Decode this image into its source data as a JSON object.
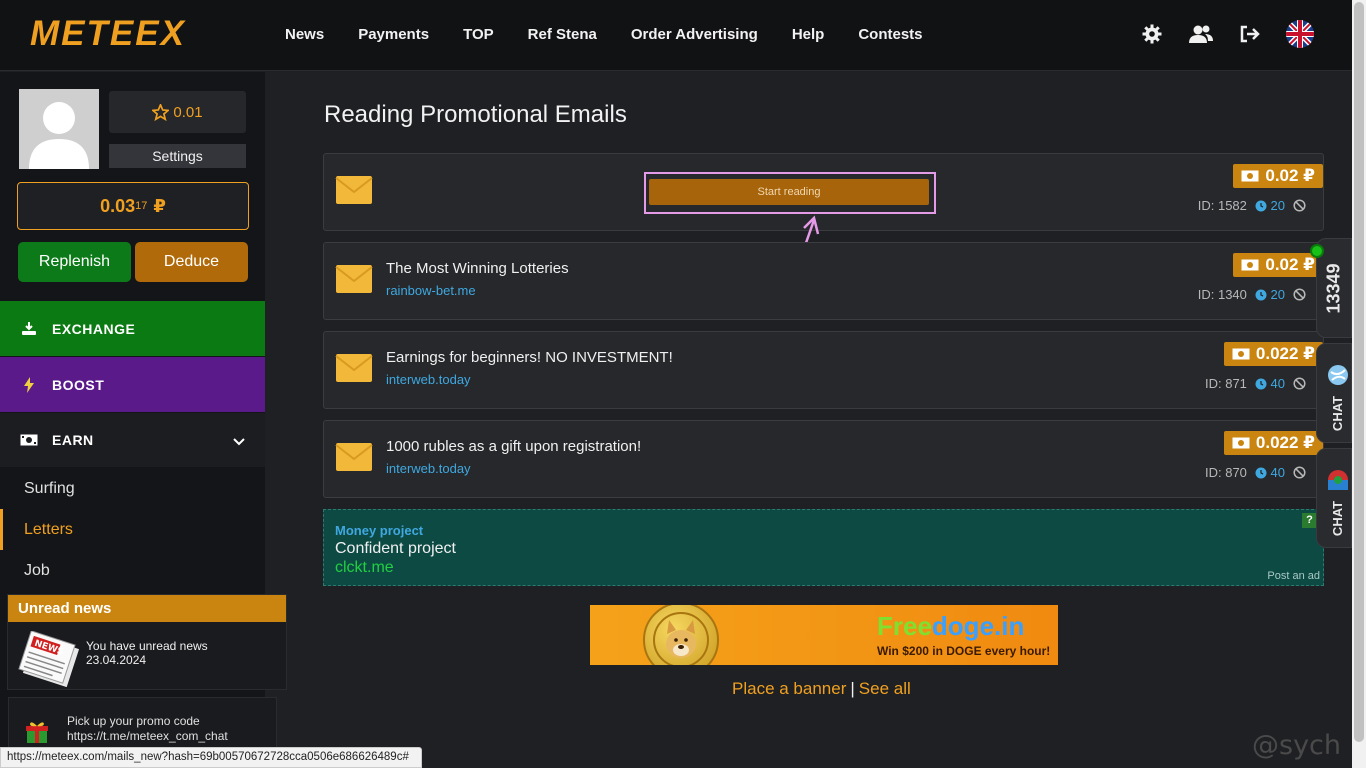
{
  "header": {
    "logo": "METEEX",
    "nav": [
      "News",
      "Payments",
      "TOP",
      "Ref Stena",
      "Order Advertising",
      "Help",
      "Contests"
    ],
    "icons": [
      "gear-icon",
      "users-icon",
      "logout-icon",
      "uk-flag-icon"
    ]
  },
  "sidebar": {
    "rating": "0.01",
    "settings_label": "Settings",
    "balance_main": "0.03",
    "balance_small": "17",
    "balance_currency": "₽",
    "replenish_label": "Replenish",
    "deduce_label": "Deduce",
    "exchange_label": "EXCHANGE",
    "boost_label": "BOOST",
    "earn_label": "EARN",
    "submenu": [
      "Surfing",
      "Letters",
      "Job"
    ],
    "news_header": "Unread news",
    "news_text": "You have unread news",
    "news_date": "23.04.2024",
    "promo_text": "Pick up your promo code",
    "promo_link": "https://t.me/meteex_com_chat"
  },
  "main": {
    "title": "Reading Promotional Emails",
    "start_reading_label": "Start reading",
    "cards": [
      {
        "title": "",
        "link": "",
        "price": "0.02 ₽",
        "id": "ID: 1582",
        "time": "20"
      },
      {
        "title": "The Most Winning Lotteries",
        "link": "rainbow-bet.me",
        "price": "0.02 ₽",
        "id": "ID: 1340",
        "time": "20"
      },
      {
        "title": "Earnings for beginners! NO INVESTMENT!",
        "link": "interweb.today",
        "price": "0.022 ₽",
        "id": "ID: 871",
        "time": "40"
      },
      {
        "title": "1000 rubles as a gift upon registration!",
        "link": "interweb.today",
        "price": "0.022 ₽",
        "id": "ID: 870",
        "time": "40"
      }
    ],
    "ad": {
      "label": "Money project",
      "title": "Confident project",
      "link": "clckt.me",
      "post": "Post an ad",
      "help": "?"
    },
    "banner": {
      "brand_a": "Free",
      "brand_b": "doge.in",
      "sub": "Win $200 in DOGE every hour!"
    },
    "place_banner": "Place a banner",
    "separator": "|",
    "see_all": "See all"
  },
  "right_tabs": {
    "online_count": "13349",
    "chat1": "CHAT",
    "chat2": "CHAT"
  },
  "statusbar_url": "https://meteex.com/mails_new?hash=69b00570672728cca0506e686626489c#",
  "watermark": "@sych",
  "colors": {
    "accent": "#f0a020",
    "green": "#0d7a1a",
    "purple": "#5a1a8a",
    "link": "#3fa8e0",
    "highlight": "#e59ae8"
  }
}
